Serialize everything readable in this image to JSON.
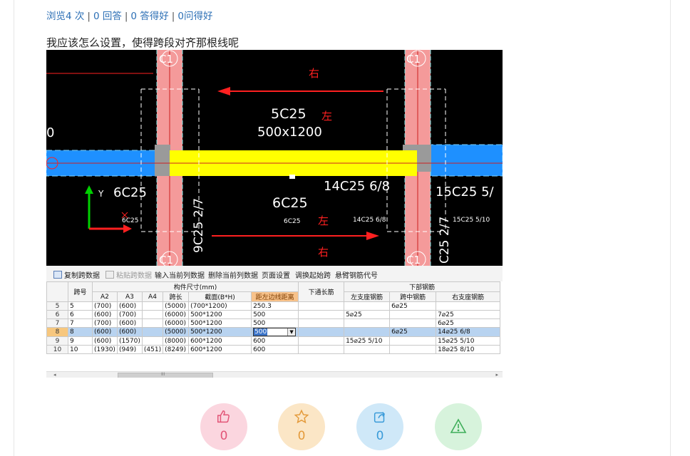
{
  "meta": {
    "views": "浏览4 次",
    "answers": "0 回答",
    "good_answers": "0 答得好",
    "good_questions": "0问得好",
    "separator": "|"
  },
  "question": "我应该怎么设置，使得跨段对齐那根线呢",
  "cad": {
    "labels": {
      "c1_top": "C1",
      "c1_top_b": "C1",
      "c1_bottom": "C1",
      "c1_bottom_b": "C1",
      "you_top": "右",
      "zuo_top": "左",
      "beam_name": "5C25",
      "beam_size": "500x1200",
      "left_zero": "0",
      "left_bot": "6C25",
      "left_small": "6C25",
      "mid_bot": "6C25",
      "mid_small": "6C25",
      "zuo_bottom": "左",
      "you_bottom": "右",
      "right_bot": "14C25 6/8",
      "right_small": "14C25 6/8",
      "far_right": "15C25 5/",
      "far_small": "15C25 5/10",
      "vert_left": "9C25 2/7",
      "vert_right": "C25 2/7",
      "axis_y": "Y"
    },
    "colors": {
      "column": "#f49a9a",
      "beam": "#ffff00",
      "slab": "#1e90ff",
      "arrow": "#ff2020",
      "axis": "#00d000"
    }
  },
  "toolbar": {
    "copy": "复制跨数据",
    "paste": "粘贴跨数据",
    "input_col": "输入当前列数据",
    "delete_col": "删除当前列数据",
    "page_setup": "页面设置",
    "swap_start": "调换起始跨",
    "cantilever": "悬臂钢筋代号"
  },
  "grid": {
    "headers": {
      "span_no": "跨号",
      "member_size": "构件尺寸(mm)",
      "a2": "A2",
      "a3": "A3",
      "a4": "A4",
      "span_len": "跨长",
      "section": "截面(B*H)",
      "left_dist": "距左边线距离",
      "top_through": "下通长筋",
      "bottom_rebar": "下部钢筋",
      "left_support": "左支座钢筋",
      "mid_span": "跨中钢筋",
      "right_support": "右支座钢筋"
    },
    "rows": [
      {
        "rn": "5",
        "no": "5",
        "a2": "(700)",
        "a3": "(600)",
        "a4": "",
        "len": "(5000)",
        "sec": "(700*1200)",
        "dist": "250.3",
        "top": "",
        "ls": "",
        "mid": "6⌀25",
        "rs": ""
      },
      {
        "rn": "6",
        "no": "6",
        "a2": "(600)",
        "a3": "(700)",
        "a4": "",
        "len": "(6000)",
        "sec": "500*1200",
        "dist": "500",
        "top": "",
        "ls": "5⌀25",
        "mid": "",
        "rs": "7⌀25"
      },
      {
        "rn": "7",
        "no": "7",
        "a2": "(700)",
        "a3": "(600)",
        "a4": "",
        "len": "(6000)",
        "sec": "500*1200",
        "dist": "500",
        "top": "",
        "ls": "",
        "mid": "",
        "rs": "6⌀25"
      },
      {
        "rn": "8",
        "no": "8",
        "a2": "(600)",
        "a3": "(600)",
        "a4": "",
        "len": "(5000)",
        "sec": "500*1200",
        "dist": "500",
        "top": "",
        "ls": "",
        "mid": "6⌀25",
        "rs": "14⌀25 6/8"
      },
      {
        "rn": "9",
        "no": "9",
        "a2": "(600)",
        "a3": "(1570)",
        "a4": "",
        "len": "(8000)",
        "sec": "600*1200",
        "dist": "600",
        "top": "",
        "ls": "15⌀25 5/10",
        "mid": "",
        "rs": "15⌀25 5/10"
      },
      {
        "rn": "10",
        "no": "10",
        "a2": "(1930)",
        "a3": "(949)",
        "a4": "(451)",
        "len": "(8249)",
        "sec": "600*1200",
        "dist": "600",
        "top": "",
        "ls": "",
        "mid": "",
        "rs": "18⌀25 8/10"
      }
    ],
    "selected_row": "8",
    "scroll_mark": "III"
  },
  "actions": {
    "like_count": "0",
    "favorite_count": "0",
    "share_count": "0"
  }
}
